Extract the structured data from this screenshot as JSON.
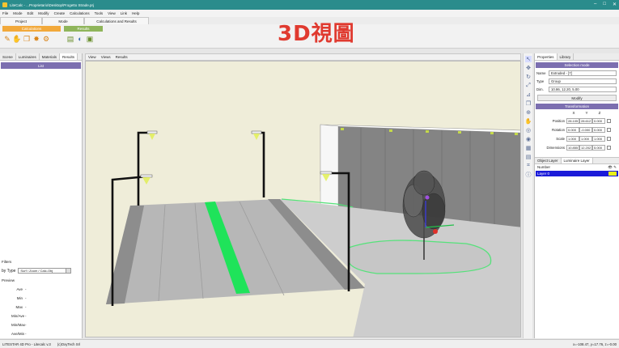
{
  "window": {
    "title": "LiteCalc - ...Proprietario\\Desktop\\Progetto Strade.prj"
  },
  "menu": [
    "File",
    "Mode",
    "Edit",
    "Modify",
    "Create",
    "Calculations",
    "Tools",
    "View",
    "Link",
    "Help"
  ],
  "ribbon": {
    "tabs": [
      "Project",
      "Mode",
      "Calculations and Results"
    ],
    "calc_group": "Calculations",
    "results_group": "Results",
    "calc_icons": [
      "lamp-icon",
      "hand-icon",
      "folder-icon",
      "light-icon",
      "calc-icon"
    ],
    "results_icons": [
      "report-icon",
      "graph-icon",
      "export-icon"
    ]
  },
  "overlay_heading": "3D視圖",
  "left_panel": {
    "tabs": [
      "Scene",
      "Luminaires",
      "Materials",
      "Results"
    ],
    "active_tab": "Results",
    "list_header": "List",
    "filters_label": "Filters",
    "by_type_label": "by Type",
    "by_type_value": "Surf / Zoom / Calc-Obj",
    "preview_label": "Preview",
    "stats": [
      {
        "k": "Ave",
        "v": "-"
      },
      {
        "k": "Min",
        "v": "-"
      },
      {
        "k": "Max",
        "v": "-"
      },
      {
        "k": "Min/Ave",
        "v": "-"
      },
      {
        "k": "Min/Max",
        "v": "-"
      },
      {
        "k": "Ave/Min",
        "v": "-"
      }
    ]
  },
  "viewport": {
    "menu": [
      "View",
      "Views",
      "Results"
    ]
  },
  "right_panel": {
    "tabs": [
      "Properties",
      "Library"
    ],
    "active_tab": "Properties",
    "selection_header": "Selection mode",
    "props": [
      {
        "k": "Name",
        "v": "Extruded - [7]"
      },
      {
        "k": "Type",
        "v": "Group"
      },
      {
        "k": "Dim.",
        "v": "10.86, 12.20, 5.00"
      }
    ],
    "modify_label": "Modify",
    "transformation_header": "Transformation",
    "axes": [
      "X",
      "Y",
      "Z"
    ],
    "transform_rows": [
      {
        "k": "Position",
        "x": "28.105",
        "y": "28.612",
        "z": "0.000"
      },
      {
        "k": "Rotation",
        "x": "0.000",
        "y": "-0.000",
        "z": "0.000"
      },
      {
        "k": "Scale",
        "x": "1.000",
        "y": "1.000",
        "z": "1.000"
      },
      {
        "k": "Dimensions",
        "x": "10.855",
        "y": "12.202",
        "z": "5.000"
      }
    ],
    "layer_tabs": [
      "Object Layer",
      "Luminaire Layer"
    ],
    "layer_active": "Luminaire Layer",
    "layer_col": "Number",
    "layer_row": "Layer 0",
    "layer_color": "#e8f01a"
  },
  "status": {
    "left": "LITESTAR 4D Pro - Litecalc v.3",
    "mid": "(c)OxyTech Srl",
    "right": "x=-108.47, y=17.76, z=-0.00"
  }
}
